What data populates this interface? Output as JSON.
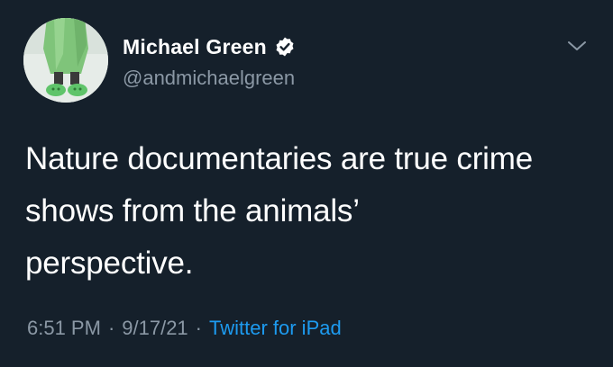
{
  "author": {
    "name": "Michael Green",
    "handle": "@andmichaelgreen",
    "verified": true,
    "avatar_icon": "profile-photo-green-coat"
  },
  "tweet": {
    "lines": [
      "Nature documentaries are true crime",
      "shows from the animals’",
      "perspective."
    ]
  },
  "meta": {
    "time": "6:51 PM",
    "separator": "·",
    "date": "9/17/21",
    "source": "Twitter for iPad"
  },
  "colors": {
    "background": "#15202b",
    "text": "#ffffff",
    "secondary": "#8b98a5",
    "link": "#1d9bf0"
  },
  "icons": {
    "menu": "chevron-down-icon",
    "verified": "verified-badge-icon"
  }
}
